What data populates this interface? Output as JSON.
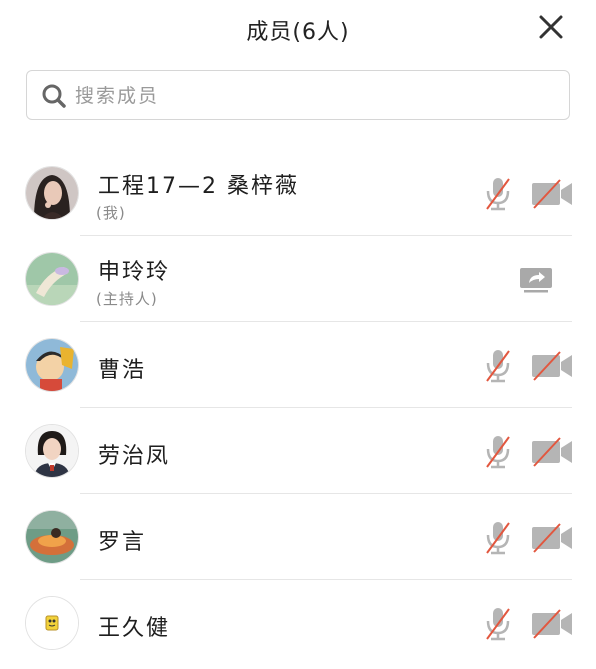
{
  "header": {
    "title": "成员(6人)"
  },
  "search": {
    "placeholder": "搜索成员"
  },
  "members": [
    {
      "name": "工程17—2 桑梓薇",
      "tag": "(我)",
      "mic": "mic-muted-icon",
      "video": "camera-off-icon"
    },
    {
      "name": "申玲玲",
      "tag": "(主持人)",
      "share": "screen-share-icon"
    },
    {
      "name": "曹浩",
      "mic": "mic-muted-icon",
      "video": "camera-off-icon"
    },
    {
      "name": "劳治凤",
      "mic": "mic-muted-icon",
      "video": "camera-off-icon"
    },
    {
      "name": "罗言",
      "mic": "mic-muted-icon",
      "video": "camera-off-icon"
    },
    {
      "name": "王久健",
      "mic": "mic-muted-icon",
      "video": "camera-off-icon"
    }
  ],
  "colors": {
    "icon_gray": "#b5b5b5",
    "muted_red": "#e2573f"
  }
}
